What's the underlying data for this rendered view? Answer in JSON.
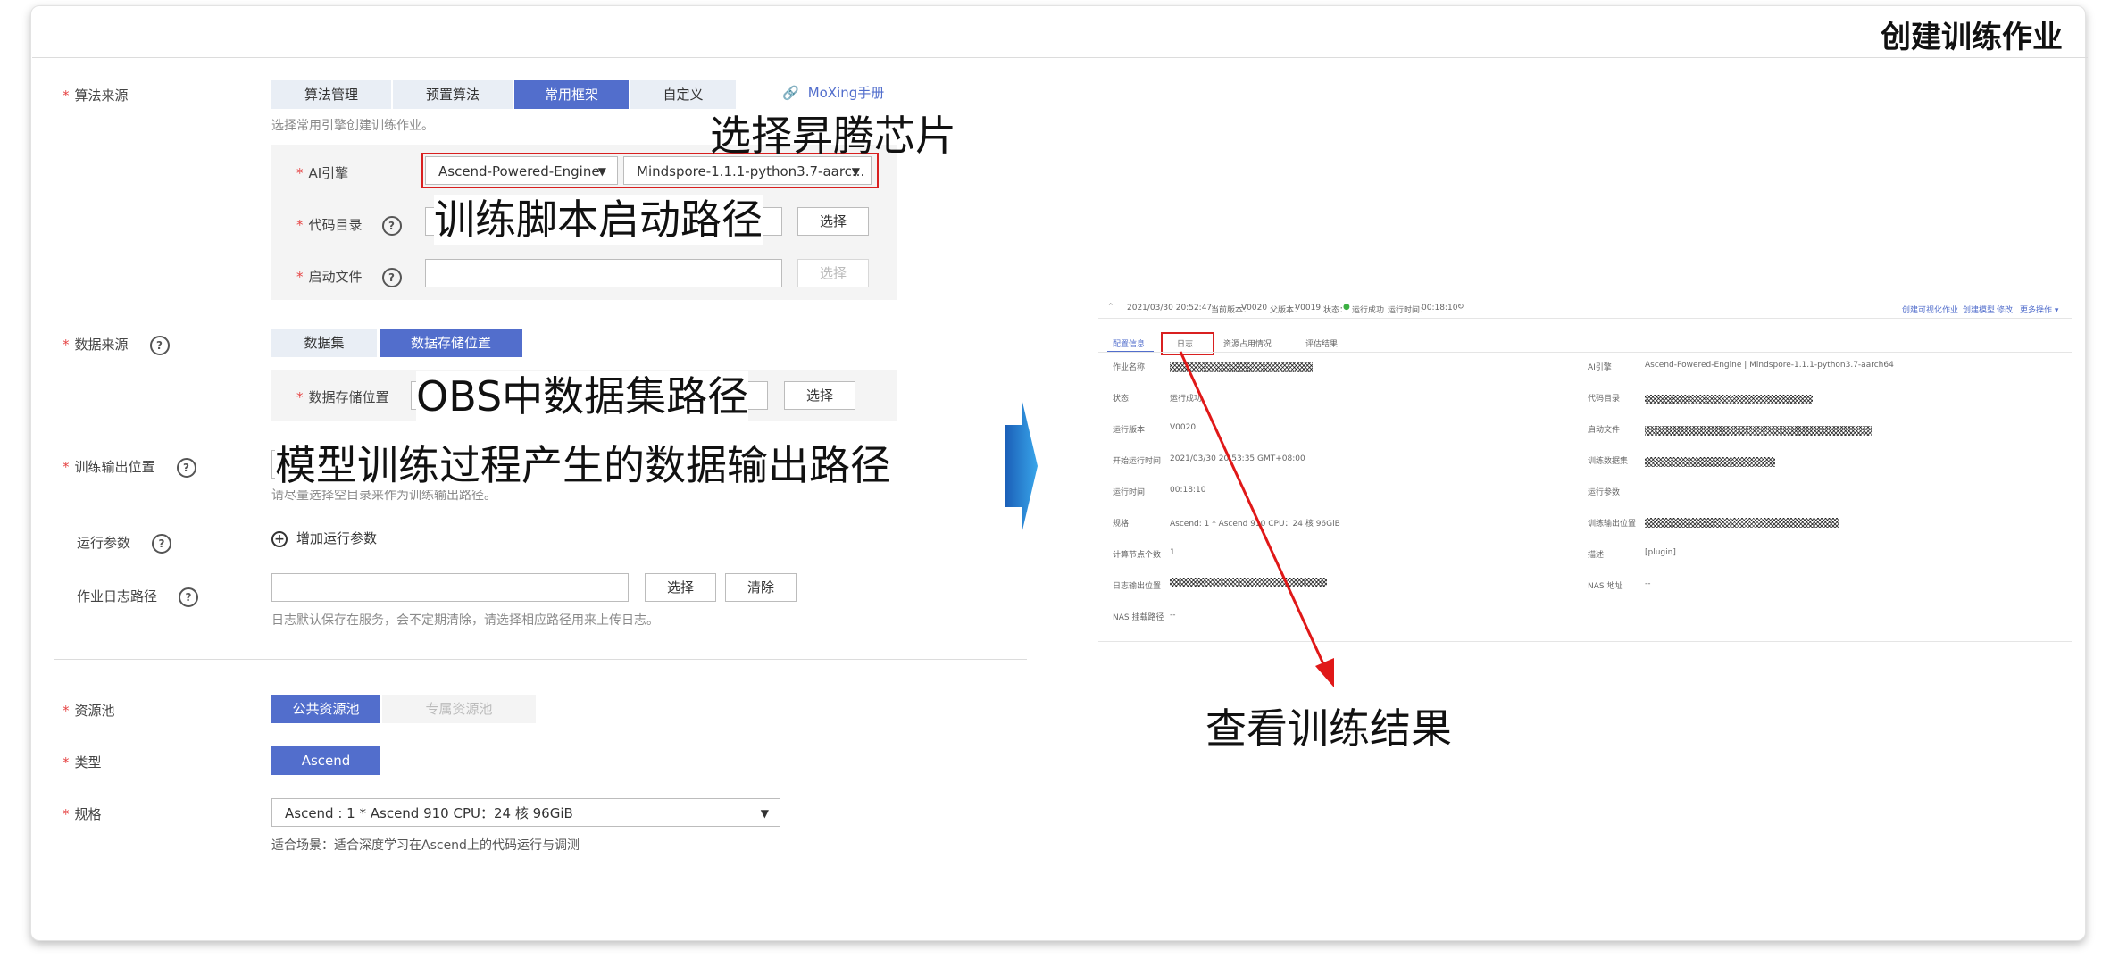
{
  "page_title": "创建训练作业",
  "algo_source": {
    "label": "算法来源",
    "tabs": [
      "算法管理",
      "预置算法",
      "常用框架",
      "自定义"
    ],
    "active_tab": 2,
    "moxing_link": "MoXing手册",
    "hint": "选择常用引擎创建训练作业。"
  },
  "ai_engine": {
    "label": "AI引擎",
    "engine_value": "Ascend-Powered-Engine",
    "version_value": "Mindspore-1.1.1-python3.7-aarc..."
  },
  "code_dir": {
    "label": "代码目录",
    "button": "选择"
  },
  "boot_file": {
    "label": "启动文件",
    "button": "选择"
  },
  "data_source": {
    "label": "数据来源",
    "tabs": [
      "数据集",
      "数据存储位置"
    ],
    "active_tab": 1,
    "storage_label": "数据存储位置",
    "button": "选择"
  },
  "train_output": {
    "label": "训练输出位置",
    "hint": "请尽量选择空目录来作为训练输出路径。"
  },
  "run_params": {
    "label": "运行参数",
    "add_label": "增加运行参数"
  },
  "job_log": {
    "label": "作业日志路径",
    "select_button": "选择",
    "clear_button": "清除",
    "hint": "日志默认保存在服务，会不定期清除，请选择相应路径用来上传日志。"
  },
  "resource_pool": {
    "label": "资源池",
    "tabs": [
      "公共资源池",
      "专属资源池"
    ],
    "active_tab": 0
  },
  "type": {
    "label": "类型",
    "value": "Ascend"
  },
  "spec": {
    "label": "规格",
    "value": "Ascend : 1 * Ascend 910 CPU：24 核 96GiB",
    "hint": "适合场景：适合深度学习在Ascend上的代码运行与调测"
  },
  "annotations": {
    "chip": "选择昇腾芯片",
    "script": "训练脚本启动路径",
    "obs": "OBS中数据集路径",
    "output": "模型训练过程产生的数据输出路径",
    "result": "查看训练结果"
  },
  "job_detail": {
    "header": {
      "datetime": "2021/03/30 20:52:47",
      "current_version_label": "当前版本：",
      "current_version": "V0020",
      "compare_version_label": "父版本：",
      "compare_version": "V0019",
      "status_label": "状态：",
      "status": "运行成功",
      "runtime_label": "运行时间：",
      "runtime": "00:18:10",
      "actions": [
        "创建可视化作业",
        "创建模型",
        "修改",
        "更多操作"
      ]
    },
    "tabs": [
      "配置信息",
      "日志",
      "资源占用情况",
      "评估结果"
    ],
    "active_tab": 0,
    "left_fields": [
      {
        "label": "作业名称",
        "value": ""
      },
      {
        "label": "状态",
        "value": "运行成功"
      },
      {
        "label": "运行版本",
        "value": "V0020"
      },
      {
        "label": "开始运行时间",
        "value": "2021/03/30 20:53:35 GMT+08:00"
      },
      {
        "label": "运行时间",
        "value": "00:18:10"
      },
      {
        "label": "规格",
        "value": "Ascend: 1 * Ascend 910 CPU：24 核 96GiB"
      },
      {
        "label": "计算节点个数",
        "value": "1"
      },
      {
        "label": "日志输出位置",
        "value": ""
      },
      {
        "label": "NAS 挂载路径",
        "value": "--"
      }
    ],
    "right_fields": [
      {
        "label": "AI引擎",
        "value": "Ascend-Powered-Engine | Mindspore-1.1.1-python3.7-aarch64"
      },
      {
        "label": "代码目录",
        "value": ""
      },
      {
        "label": "启动文件",
        "value": ""
      },
      {
        "label": "训练数据集",
        "value": ""
      },
      {
        "label": "运行参数",
        "value": ""
      },
      {
        "label": "训练输出位置",
        "value": ""
      },
      {
        "label": "描述",
        "value": "[plugin]"
      },
      {
        "label": "NAS 地址",
        "value": "--"
      }
    ]
  }
}
